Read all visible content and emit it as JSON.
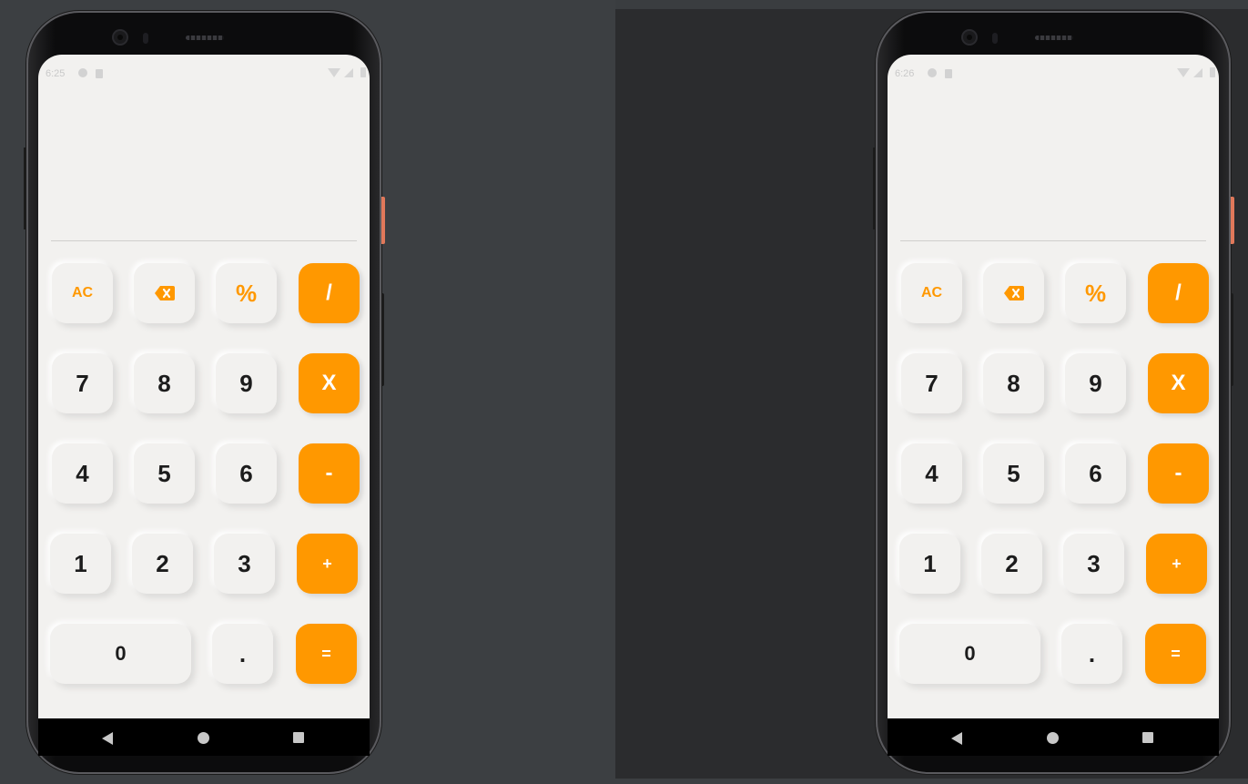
{
  "colors": {
    "accent": "#ff9800",
    "screen_bg": "#f2f1ef",
    "digit_text": "#1c1c1c",
    "operator_text": "#ffffff"
  },
  "phones": [
    {
      "status": {
        "time": "6:25"
      },
      "display": {
        "value": ""
      },
      "keys": {
        "clear": "AC",
        "backspace_icon": "backspace-icon",
        "percent": "%",
        "divide": "/",
        "seven": "7",
        "eight": "8",
        "nine": "9",
        "multiply": "X",
        "four": "4",
        "five": "5",
        "six": "6",
        "minus": "-",
        "one": "1",
        "two": "2",
        "three": "3",
        "plus": "+",
        "zero": "0",
        "dot": ".",
        "equals": "="
      }
    },
    {
      "status": {
        "time": "6:26"
      },
      "display": {
        "value": ""
      },
      "keys": {
        "clear": "AC",
        "backspace_icon": "backspace-icon",
        "percent": "%",
        "divide": "/",
        "seven": "7",
        "eight": "8",
        "nine": "9",
        "multiply": "X",
        "four": "4",
        "five": "5",
        "six": "6",
        "minus": "-",
        "one": "1",
        "two": "2",
        "three": "3",
        "plus": "+",
        "zero": "0",
        "dot": ".",
        "equals": "="
      }
    }
  ],
  "nav_icons": [
    "back-icon",
    "home-icon",
    "recents-icon"
  ]
}
